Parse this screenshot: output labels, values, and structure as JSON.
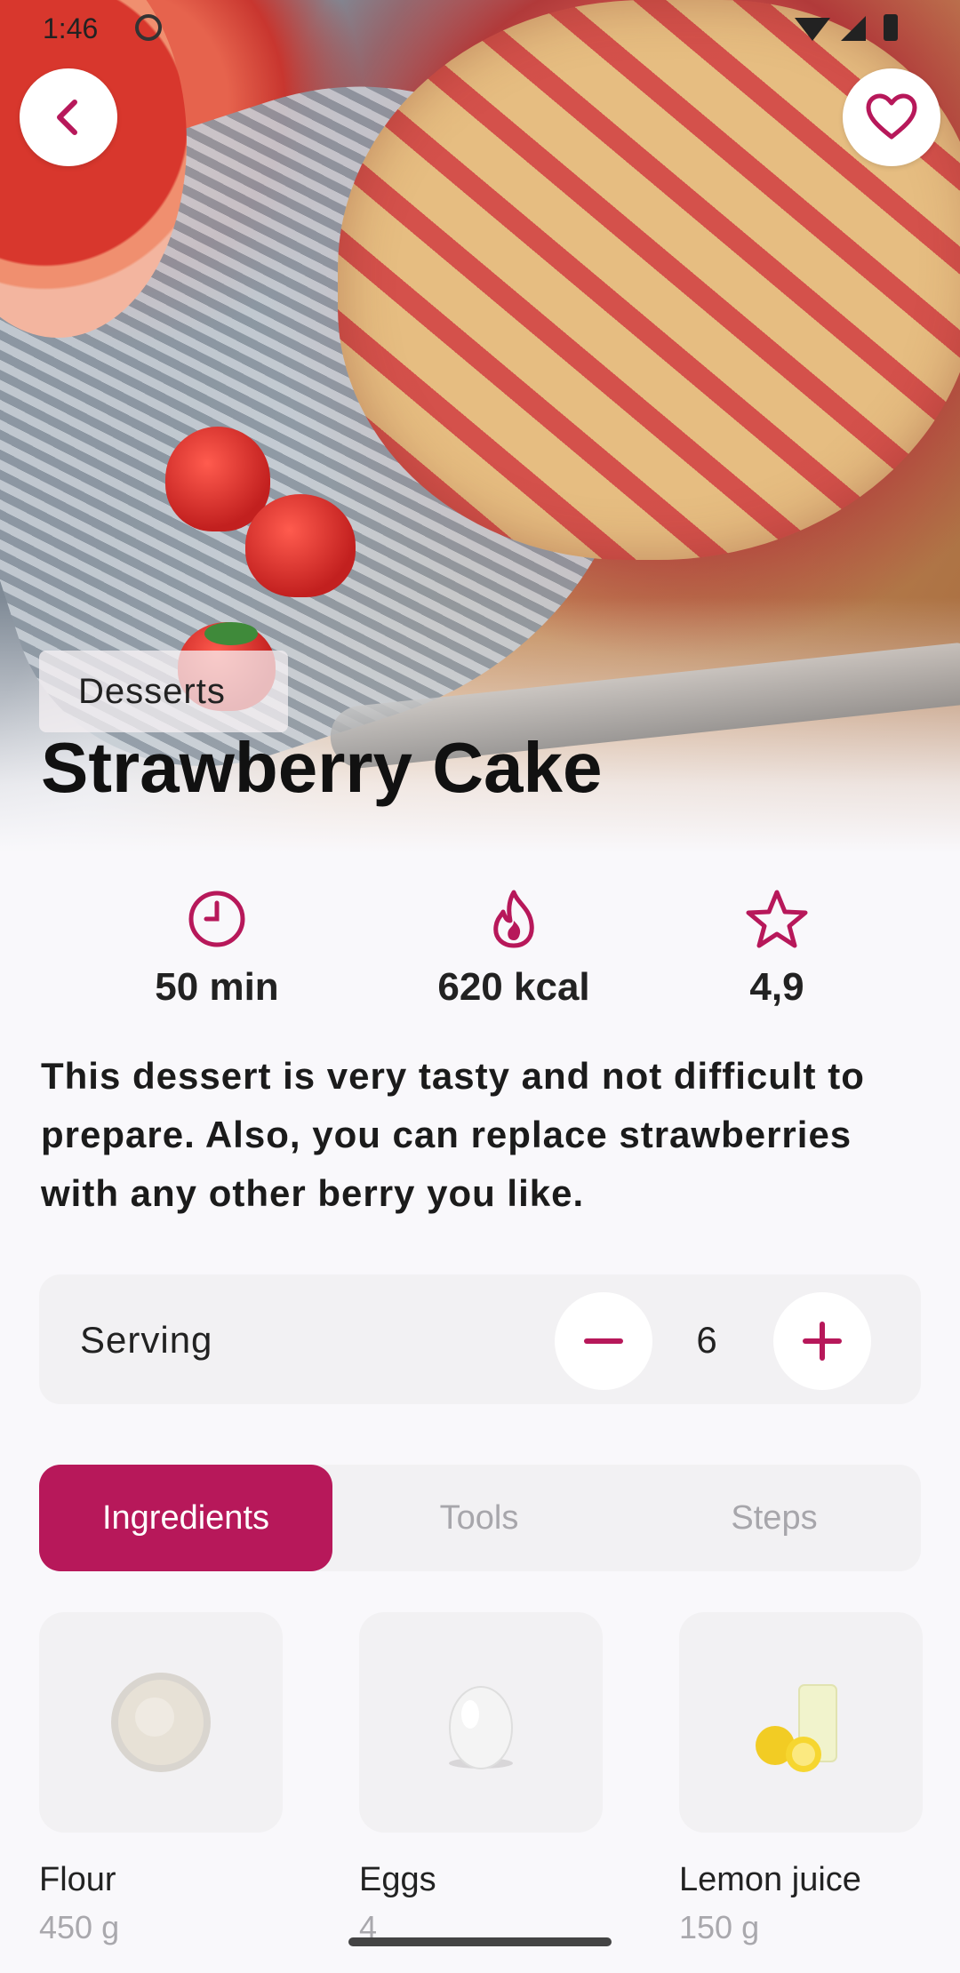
{
  "status": {
    "time": "1:46"
  },
  "hero": {
    "category": "Desserts",
    "title": "Strawberry Cake"
  },
  "stats": [
    {
      "icon": "clock-icon",
      "value": "50 min"
    },
    {
      "icon": "flame-icon",
      "value": "620 kcal"
    },
    {
      "icon": "star-icon",
      "value": "4,9"
    }
  ],
  "description": "This dessert is very tasty and not difficult to prepare. Also, you can replace strawberries with any other berry you like.",
  "serving": {
    "label": "Serving",
    "count": "6"
  },
  "tabs": [
    {
      "label": "Ingredients",
      "active": true
    },
    {
      "label": "Tools",
      "active": false
    },
    {
      "label": "Steps",
      "active": false
    }
  ],
  "ingredients": [
    {
      "name": "Flour",
      "amount": "450 g"
    },
    {
      "name": "Eggs",
      "amount": "4"
    },
    {
      "name": "Lemon juice",
      "amount": "150 g"
    }
  ],
  "colors": {
    "accent": "#b7185a",
    "background": "#f9f8fb",
    "surface": "#f2f1f3"
  }
}
